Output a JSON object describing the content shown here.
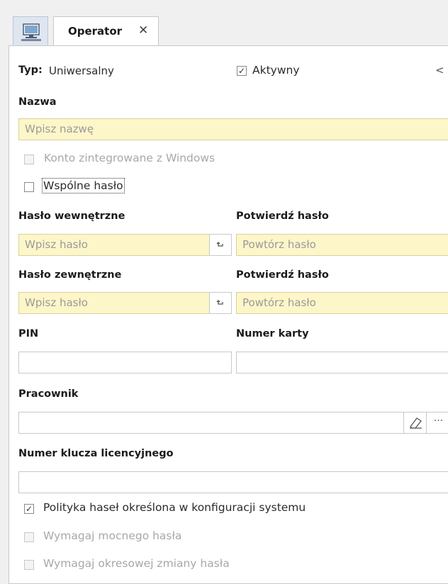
{
  "tab": {
    "title": "Operator",
    "close_glyph": "✕",
    "icon": "monitor-icon"
  },
  "header": {
    "typ_label": "Typ:",
    "typ_value": "Uniwersalny",
    "active_label": "Aktywny",
    "collapse_glyph": "<"
  },
  "name": {
    "label": "Nazwa",
    "placeholder": "Wpisz nazwę"
  },
  "options": {
    "windows_account": "Konto zintegrowane z Windows",
    "shared_password": "Wspólne hasło"
  },
  "internal_password": {
    "label": "Hasło wewnętrzne",
    "placeholder": "Wpisz hasło",
    "confirm_label": "Potwierdź hasło",
    "confirm_placeholder": "Powtórz hasło"
  },
  "external_password": {
    "label": "Hasło zewnętrzne",
    "placeholder": "Wpisz hasło",
    "confirm_label": "Potwierdź hasło",
    "confirm_placeholder": "Powtórz hasło"
  },
  "pin": {
    "label": "PIN",
    "value": ""
  },
  "card": {
    "label": "Numer karty",
    "value": ""
  },
  "employee": {
    "label": "Pracownik",
    "value": "",
    "more_glyph": "···"
  },
  "license": {
    "label": "Numer klucza licencyjnego",
    "value": ""
  },
  "policy": {
    "system_policy": "Polityka haseł określona w konfiguracji systemu",
    "strong_password": "Wymagaj mocnego hasła",
    "periodic_change": "Wymagaj okresowej zmiany hasła"
  },
  "checkmark": "✓"
}
